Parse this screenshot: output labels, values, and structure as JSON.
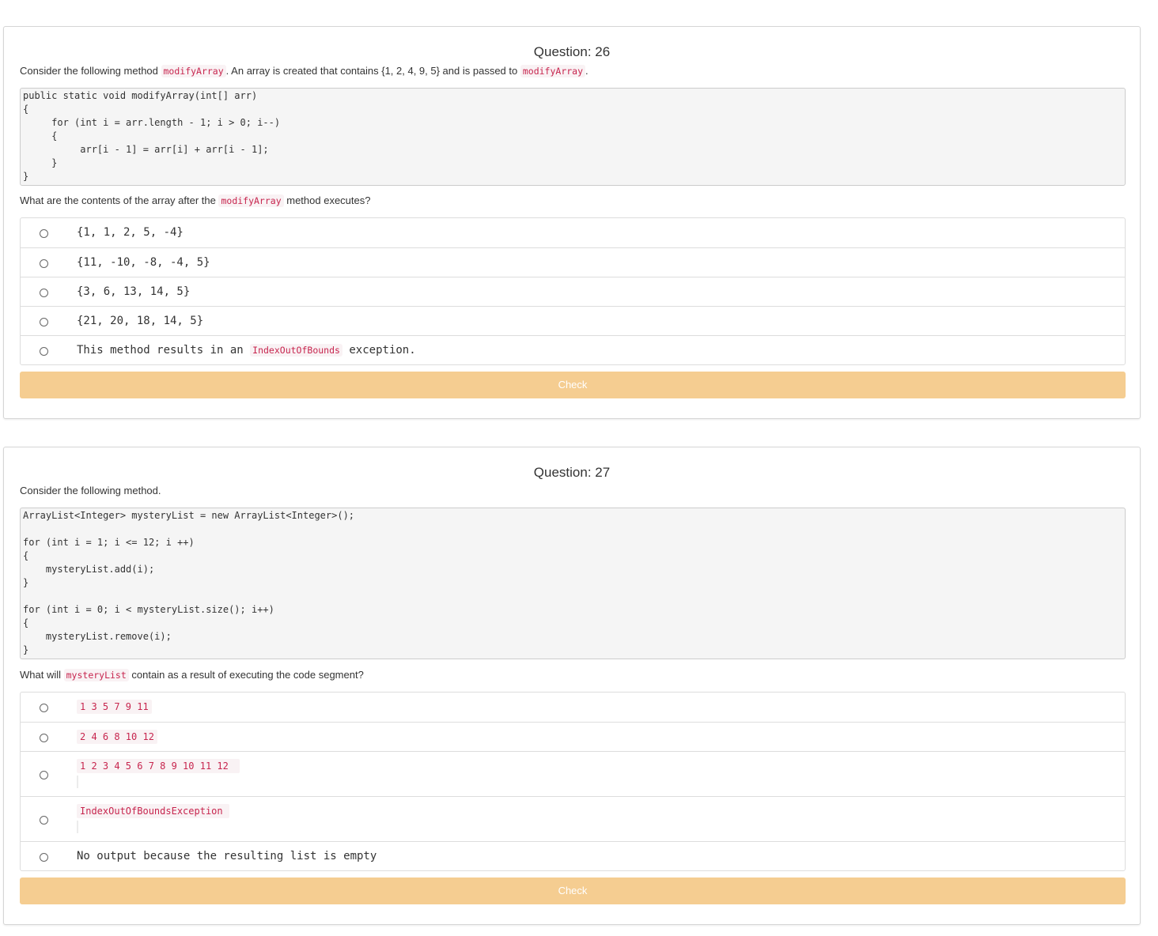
{
  "q26": {
    "title": "Question: 26",
    "intro_pre": "Consider the following method ",
    "intro_code1": "modifyArray",
    "intro_mid": ". An array is created that contains {1, 2, 4, 9, 5} and is passed to ",
    "intro_code2": "modifyArray",
    "intro_post": ".",
    "code": "public static void modifyArray(int[] arr)\n{\n     for (int i = arr.length - 1; i > 0; i--)\n     {\n          arr[i - 1] = arr[i] + arr[i - 1];\n     }\n}",
    "question_pre": "What are the contents of the array after the ",
    "question_code": "modifyArray",
    "question_post": " method executes?",
    "choices": [
      "{1, 1, 2, 5, -4}",
      "{11, -10, -8, -4, 5}",
      "{3, 6, 13, 14, 5}",
      "{21, 20, 18, 14, 5}"
    ],
    "choice5_pre": "This method results in an ",
    "choice5_code": "IndexOutOfBounds",
    "choice5_post": " exception.",
    "check_label": "Check"
  },
  "q27": {
    "title": "Question: 27",
    "intro": "Consider the following method.",
    "code": "ArrayList<Integer> mysteryList = new ArrayList<Integer>();\n\nfor (int i = 1; i <= 12; i ++)\n{\n    mysteryList.add(i);\n}\n\nfor (int i = 0; i < mysteryList.size(); i++)\n{\n    mysteryList.remove(i);\n}",
    "question_pre": "What will ",
    "question_code": "mysteryList",
    "question_post": " contain as a result of executing the code segment?",
    "choices_code": [
      "1 3 5 7 9 11",
      "2 4 6 8 10 12",
      "1 2 3 4 5 6 7 8 9 10 11 12",
      "IndexOutOfBoundsException"
    ],
    "choice5": "No output because the resulting list is empty",
    "check_label": "Check"
  },
  "colors": {
    "check_button": "#f5cd91",
    "inline_code": "#c7254e",
    "code_background": "#f5f5f5"
  }
}
